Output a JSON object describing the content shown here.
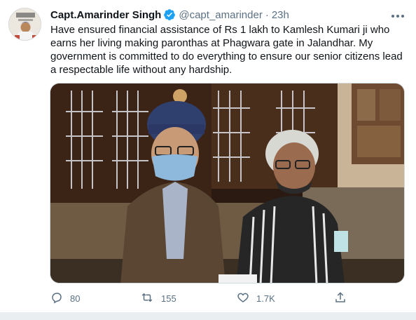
{
  "tweet": {
    "author_name": "Capt.Amarinder Singh",
    "handle": "@capt_amarinder",
    "separator": "·",
    "time": "23h",
    "text": "Have ensured financial assistance of Rs 1 lakh to Kamlesh Kumari ji who earns her living making paronthas at Phagwara gate in Jalandhar. My government is committed to do everything to ensure our senior citizens lead a respectable life without any hardship.",
    "more_icon": "more-horizontal-icon",
    "verified_icon": "verified-badge-icon",
    "accent_color": "#1da1f2"
  },
  "actions": {
    "reply_count": "80",
    "retweet_count": "155",
    "like_count": "1.7K",
    "reply_icon": "reply-icon",
    "retweet_icon": "retweet-icon",
    "like_icon": "heart-icon",
    "share_icon": "share-icon"
  }
}
